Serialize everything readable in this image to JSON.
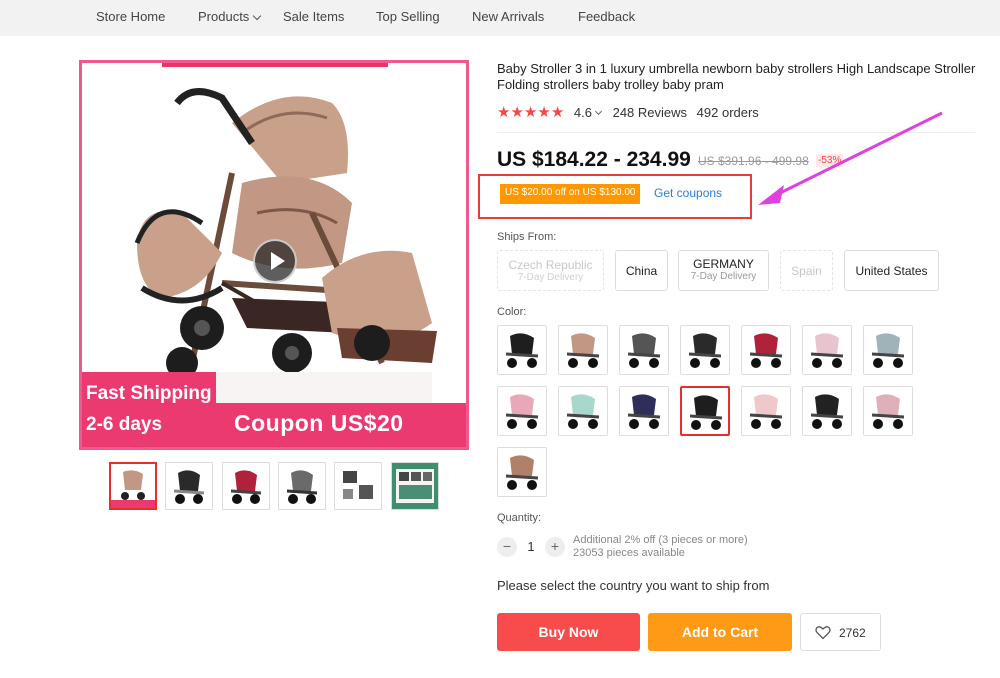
{
  "nav": {
    "items": [
      "Store Home",
      "Products",
      "Sale Items",
      "Top Selling",
      "New Arrivals",
      "Feedback"
    ]
  },
  "gallery": {
    "badge_line1": "Fast Shipping",
    "badge_line2": "2-6 days",
    "coupon_text": "Coupon  US$20",
    "thumbnails": 6,
    "active_thumbnail": 1
  },
  "product": {
    "title": "Baby Stroller 3 in 1 luxury umbrella newborn baby strollers High Landscape Stroller Folding strollers baby trolley baby pram",
    "rating": "4.6",
    "stars": 5,
    "reviews": "248 Reviews",
    "orders": "492 orders",
    "price": "US $184.22 - 234.99",
    "original_price": "US $391.96 - 499.98",
    "discount": "-53%",
    "coupon_tag": "US $20.00 off on US $130.00",
    "get_coupons": "Get coupons"
  },
  "shipping": {
    "label": "Ships From:",
    "options": [
      {
        "name": "Czech Republic",
        "sub": "7-Day Delivery",
        "enabled": false
      },
      {
        "name": "China",
        "sub": "",
        "enabled": true
      },
      {
        "name": "GERMANY",
        "sub": "7-Day Delivery",
        "enabled": true
      },
      {
        "name": "Spain",
        "sub": "",
        "enabled": false
      },
      {
        "name": "United States",
        "sub": "",
        "enabled": true
      }
    ]
  },
  "color": {
    "label": "Color:",
    "count": 15,
    "selected_index": 10
  },
  "quantity": {
    "label": "Quantity:",
    "value": "1",
    "minus": "−",
    "plus": "+",
    "note_line1": "Additional 2% off (3 pieces or more)",
    "note_line2": "23053 pieces available"
  },
  "ship_prompt": "Please select the country you want to ship from",
  "actions": {
    "buy_now": "Buy Now",
    "add_to_cart": "Add to Cart",
    "wishlist_count": "2762"
  },
  "colors": {
    "accent_red": "#f84b4b",
    "accent_orange": "#ff9a17",
    "brand_pink": "#ea3a6f",
    "link_blue": "#2a7fd4",
    "annotation_magenta": "#e040e0"
  }
}
